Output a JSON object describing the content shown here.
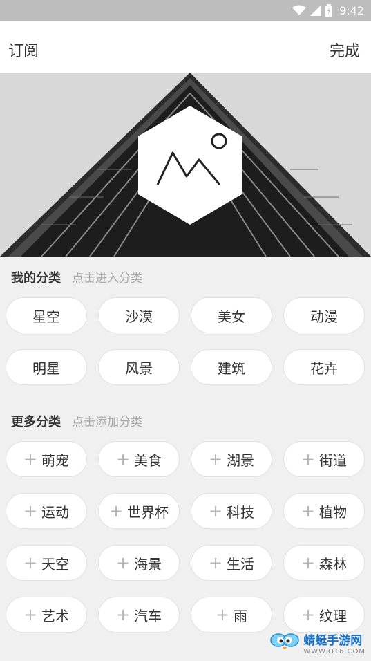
{
  "status": {
    "time": "9:42"
  },
  "header": {
    "title": "订阅",
    "done_label": "完成"
  },
  "my_categories": {
    "title": "我的分类",
    "hint": "点击进入分类",
    "items": [
      "星空",
      "沙漠",
      "美女",
      "动漫",
      "明星",
      "风景",
      "建筑",
      "花卉"
    ]
  },
  "more_categories": {
    "title": "更多分类",
    "hint": "点击添加分类",
    "items": [
      "萌宠",
      "美食",
      "湖景",
      "街道",
      "运动",
      "世界杯",
      "科技",
      "植物",
      "天空",
      "海景",
      "生活",
      "森林",
      "艺术",
      "汽车",
      "雨",
      "纹理"
    ]
  },
  "watermark": {
    "title": "蜻蜓手游网",
    "url": "WWW.QT6.COM"
  }
}
